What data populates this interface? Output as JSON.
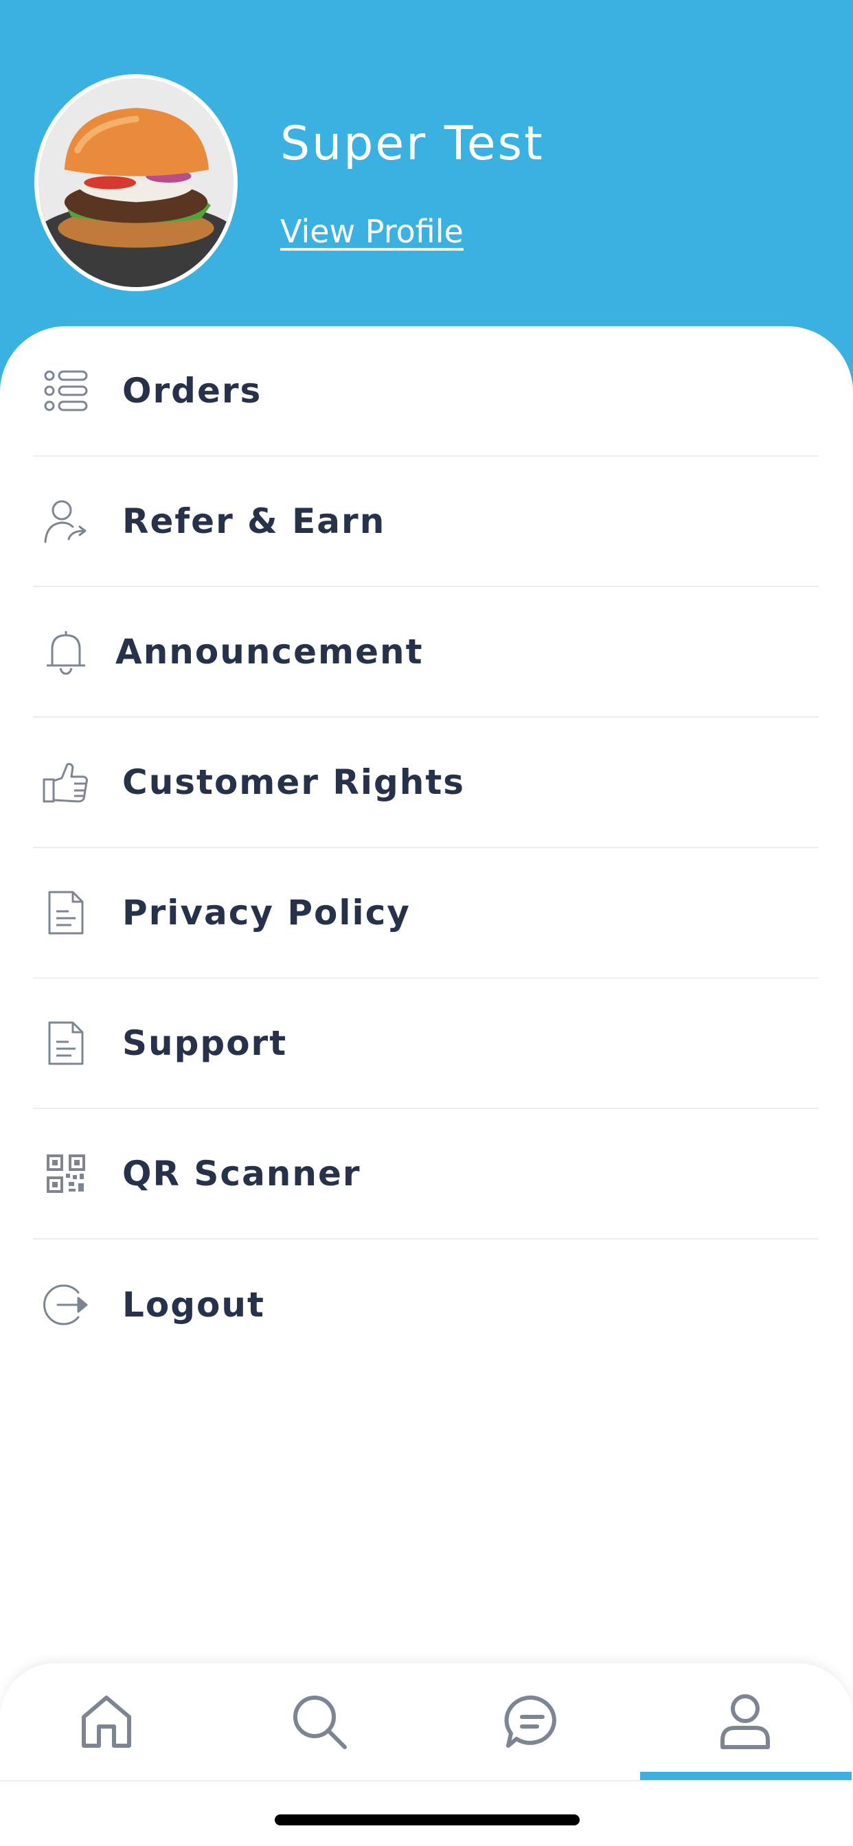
{
  "header": {
    "user_name": "Super Test",
    "view_profile_label": "View Profile"
  },
  "menu": {
    "items": [
      {
        "label": "Orders",
        "icon": "orders-list-icon"
      },
      {
        "label": "Refer & Earn",
        "icon": "refer-user-icon"
      },
      {
        "label": "Announcement",
        "icon": "bell-icon"
      },
      {
        "label": "Customer Rights",
        "icon": "thumbs-up-icon"
      },
      {
        "label": "Privacy Policy",
        "icon": "document-icon"
      },
      {
        "label": "Support",
        "icon": "document-icon"
      },
      {
        "label": "QR Scanner",
        "icon": "qr-code-icon"
      },
      {
        "label": "Logout",
        "icon": "logout-icon"
      }
    ]
  },
  "bottom_nav": {
    "items": [
      {
        "icon": "home-icon",
        "active": false
      },
      {
        "icon": "search-icon",
        "active": false
      },
      {
        "icon": "chat-icon",
        "active": false
      },
      {
        "icon": "profile-icon",
        "active": true
      }
    ]
  },
  "colors": {
    "header_bg": "#3ab1e0",
    "text_dark": "#27324a",
    "icon_gray": "#7d8593",
    "active_indicator": "#3ab1e0"
  }
}
